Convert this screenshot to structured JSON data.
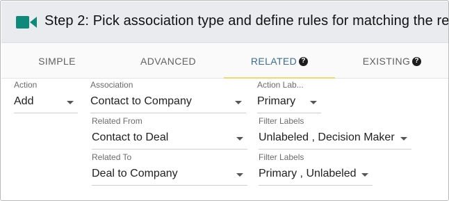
{
  "header": {
    "icon": "video-camera-icon",
    "icon_color": "#0f8a7a",
    "title": "Step 2: Pick association type and define rules for matching the re"
  },
  "tabs": [
    {
      "label": "SIMPLE",
      "active": false,
      "help": false
    },
    {
      "label": "ADVANCED",
      "active": false,
      "help": false
    },
    {
      "label": "RELATED",
      "active": true,
      "help": true
    },
    {
      "label": "EXISTING",
      "active": false,
      "help": true
    }
  ],
  "help_glyph": "?",
  "accent_color": "#f0d870",
  "form": {
    "action": {
      "label": "Action",
      "value": "Add"
    },
    "association": {
      "label": "Association",
      "value": "Contact to Company"
    },
    "action_label": {
      "label": "Action Lab...",
      "value": "Primary"
    },
    "related_from": {
      "label": "Related From",
      "value": "Contact to Deal"
    },
    "filter_labels_1": {
      "label": "Filter Labels",
      "value": "Unlabeled , Decision Maker"
    },
    "related_to": {
      "label": "Related To",
      "value": "Deal to Company"
    },
    "filter_labels_2": {
      "label": "Filter Labels",
      "value": "Primary , Unlabeled"
    }
  }
}
